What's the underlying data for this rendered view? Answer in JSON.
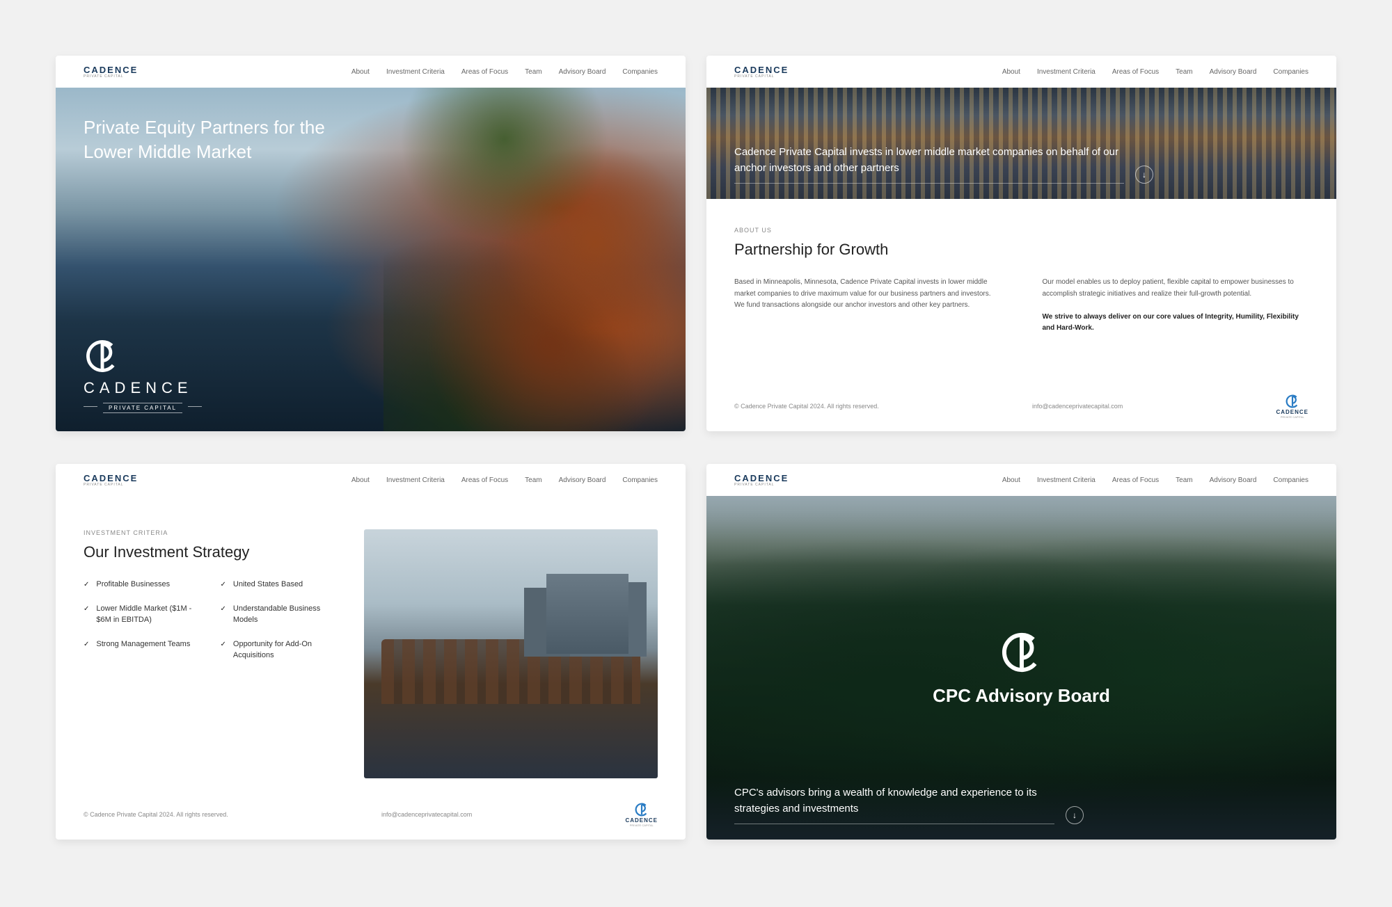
{
  "brand": {
    "name": "CADENCE",
    "sub": "PRIVATE CAPITAL"
  },
  "nav": [
    "About",
    "Investment Criteria",
    "Areas of Focus",
    "Team",
    "Advisory Board",
    "Companies"
  ],
  "card1": {
    "headline": "Private Equity Partners for the Lower Middle Market"
  },
  "card2": {
    "hero": "Cadence Private Capital invests in lower middle market companies on behalf of our anchor investors and other partners",
    "kicker": "ABOUT US",
    "heading": "Partnership for Growth",
    "col1": "Based in Minneapolis, Minnesota, Cadence Private Capital invests in lower middle market companies to drive maximum value for our business partners and investors. We fund transactions alongside our anchor investors and other key partners.",
    "col2a": "Our model enables us to deploy patient, flexible capital to empower businesses to accomplish strategic initiatives and realize their full-growth potential.",
    "col2b": "We strive to always deliver on our core values of Integrity, Humility, Flexibility and Hard-Work."
  },
  "card3": {
    "kicker": "INVESTMENT CRITERIA",
    "heading": "Our Investment Strategy",
    "items": [
      "Profitable Businesses",
      "United States Based",
      "Lower Middle Market ($1M - $6M in EBITDA)",
      "Understandable Business Models",
      "Strong Management Teams",
      "Opportunity for Add-On Acquisitions"
    ]
  },
  "card4": {
    "heading": "CPC Advisory Board",
    "sub": "CPC's advisors bring a wealth of knowledge and experience to its strategies and investments"
  },
  "footer": {
    "copyright": "© Cadence Private Capital 2024. All rights reserved.",
    "email": "info@cadenceprivatecapital.com"
  }
}
